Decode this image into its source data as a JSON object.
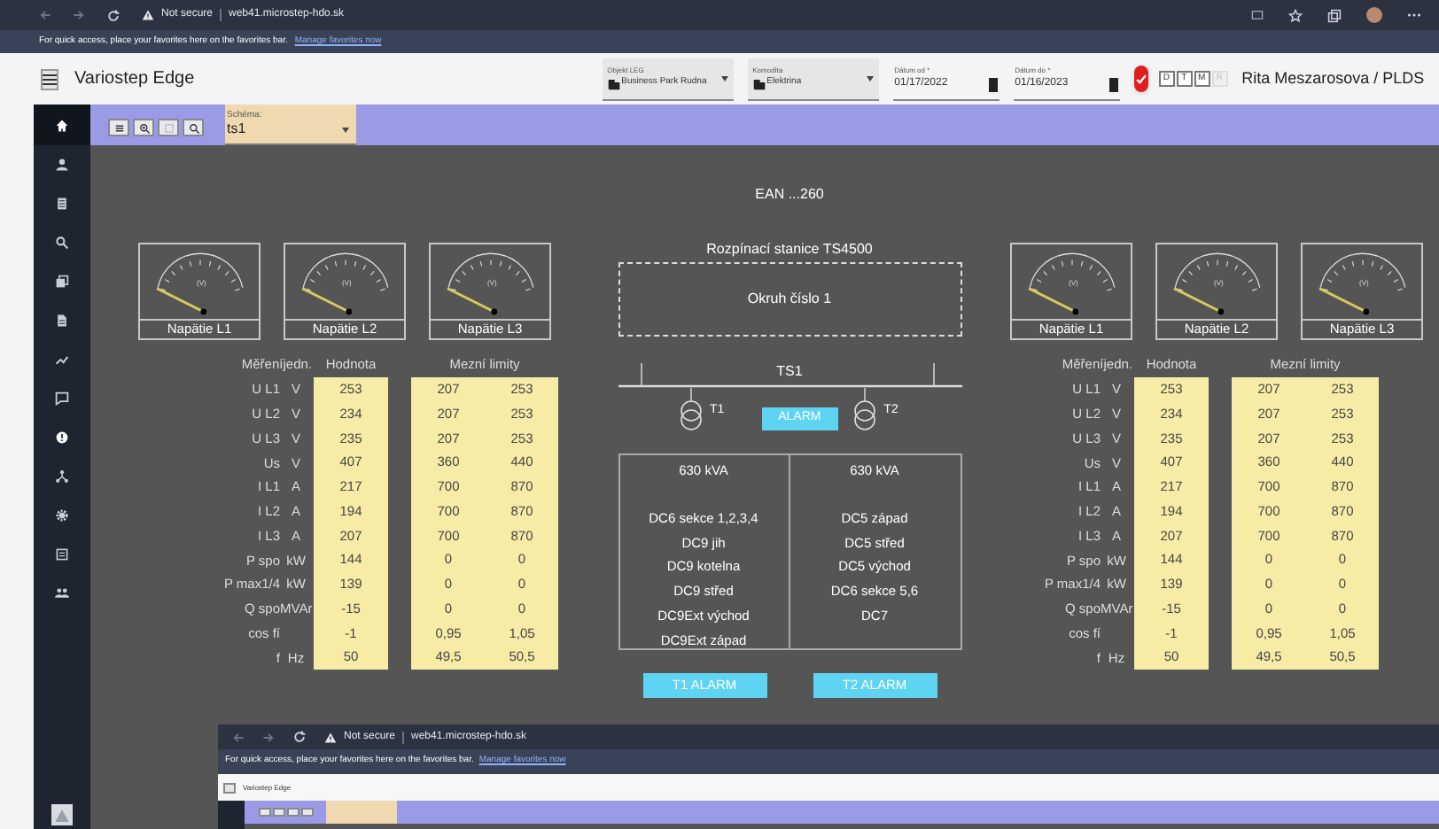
{
  "browser": {
    "security": "Not secure",
    "url": "web41.microstep-hdo.sk",
    "favorites_hint": "For quick access, place your favorites here on the favorites bar.",
    "favorites_link": "Manage favorites now"
  },
  "app": {
    "title": "Variostep Edge",
    "filters": [
      {
        "kind": "select",
        "label": "Objekt LEG",
        "value": "Business Park Rudna"
      },
      {
        "kind": "select",
        "label": "Komodita",
        "value": "Elektrina"
      },
      {
        "kind": "date",
        "label": "Dátum od *",
        "value": "01/17/2022"
      },
      {
        "kind": "date",
        "label": "Dátum do *",
        "value": "01/16/2023"
      }
    ],
    "period_buttons": [
      {
        "label": "D",
        "disabled": false
      },
      {
        "label": "T",
        "disabled": false
      },
      {
        "label": "M",
        "disabled": false
      },
      {
        "label": "R",
        "disabled": true
      }
    ],
    "user": "Rita Meszarosova / PLDS"
  },
  "toolbar": {
    "schema_label": "Schéma:",
    "schema_value": "ts1"
  },
  "diagram": {
    "ean": "EAN ...260",
    "station": "Rozpínací stanice TS4500",
    "circuit": "Okruh číslo 1",
    "bus": "TS1",
    "transformers": [
      "T1",
      "T2"
    ],
    "alarm": "ALARM",
    "feeders": [
      {
        "rating": "630 kVA",
        "outlets": [
          "DC6 sekce 1,2,3,4",
          "DC9 jih",
          "DC9 kotelna",
          "DC9 střed",
          "DC9Ext východ",
          "DC9Ext západ"
        ]
      },
      {
        "rating": "630 kVA",
        "outlets": [
          "DC5 západ",
          "DC5 střed",
          "DC5 východ",
          "DC6 sekce 5,6",
          "DC7"
        ]
      }
    ],
    "alarm_buttons": [
      "T1 ALARM",
      "T2 ALARM"
    ]
  },
  "panels": [
    {
      "gauges": [
        {
          "unit": "(V)",
          "label": "Napätie L1"
        },
        {
          "unit": "(V)",
          "label": "Napätie L2"
        },
        {
          "unit": "(V)",
          "label": "Napätie L3"
        }
      ],
      "headers": {
        "measure": "Měřeníjedn.",
        "value": "Hodnota",
        "limits": "Mezní limity"
      },
      "rows": [
        {
          "name": "U L1",
          "unit": "V",
          "value": "253",
          "min": "207",
          "max": "253"
        },
        {
          "name": "U L2",
          "unit": "V",
          "value": "234",
          "min": "207",
          "max": "253"
        },
        {
          "name": "U L3",
          "unit": "V",
          "value": "235",
          "min": "207",
          "max": "253"
        },
        {
          "name": "Us",
          "unit": "V",
          "value": "407",
          "min": "360",
          "max": "440"
        },
        {
          "name": "I L1",
          "unit": "A",
          "value": "217",
          "min": "700",
          "max": "870"
        },
        {
          "name": "I L2",
          "unit": "A",
          "value": "194",
          "min": "700",
          "max": "870"
        },
        {
          "name": "I L3",
          "unit": "A",
          "value": "207",
          "min": "700",
          "max": "870"
        },
        {
          "name": "P spo",
          "unit": "kW",
          "value": "144",
          "min": "0",
          "max": "0"
        },
        {
          "name": "P max1/4",
          "unit": "kW",
          "value": "139",
          "min": "0",
          "max": "0"
        },
        {
          "name": "Q spo",
          "unit": "MVAr",
          "value": "-15",
          "min": "0",
          "max": "0"
        },
        {
          "name": "cos fí",
          "value": "-1",
          "min": "0,95",
          "max": "1,05"
        },
        {
          "name": "f",
          "unit": "Hz",
          "value": "50",
          "min": "49,5",
          "max": "50,5"
        }
      ]
    },
    {
      "gauges": [
        {
          "unit": "(V)",
          "label": "Napätie L1"
        },
        {
          "unit": "(V)",
          "label": "Napätie L2"
        },
        {
          "unit": "(V)",
          "label": "Napätie L3"
        }
      ],
      "headers": {
        "measure": "Měřeníjedn.",
        "value": "Hodnota",
        "limits": "Mezní limity"
      },
      "rows": [
        {
          "name": "U L1",
          "unit": "V",
          "value": "253",
          "min": "207",
          "max": "253"
        },
        {
          "name": "U L2",
          "unit": "V",
          "value": "234",
          "min": "207",
          "max": "253"
        },
        {
          "name": "U L3",
          "unit": "V",
          "value": "235",
          "min": "207",
          "max": "253"
        },
        {
          "name": "Us",
          "unit": "V",
          "value": "407",
          "min": "360",
          "max": "440"
        },
        {
          "name": "I L1",
          "unit": "A",
          "value": "217",
          "min": "700",
          "max": "870"
        },
        {
          "name": "I L2",
          "unit": "A",
          "value": "194",
          "min": "700",
          "max": "870"
        },
        {
          "name": "I L3",
          "unit": "A",
          "value": "207",
          "min": "700",
          "max": "870"
        },
        {
          "name": "P spo",
          "unit": "kW",
          "value": "144",
          "min": "0",
          "max": "0"
        },
        {
          "name": "P max1/4",
          "unit": "kW",
          "value": "139",
          "min": "0",
          "max": "0"
        },
        {
          "name": "Q spo",
          "unit": "MVAr",
          "value": "-15",
          "min": "0",
          "max": "0"
        },
        {
          "name": "cos fí",
          "value": "-1",
          "min": "0,95",
          "max": "1,05"
        },
        {
          "name": "f",
          "unit": "Hz",
          "value": "50",
          "min": "49,5",
          "max": "50,5"
        }
      ]
    }
  ],
  "inner_screen": {
    "security": "Not secure",
    "url": "web41.microstep-hdo.sk",
    "favorites_hint": "For quick access, place your favorites here on the favorites bar.",
    "favorites_link": "Manage favorites now",
    "app_title": "Variostep Edge"
  }
}
